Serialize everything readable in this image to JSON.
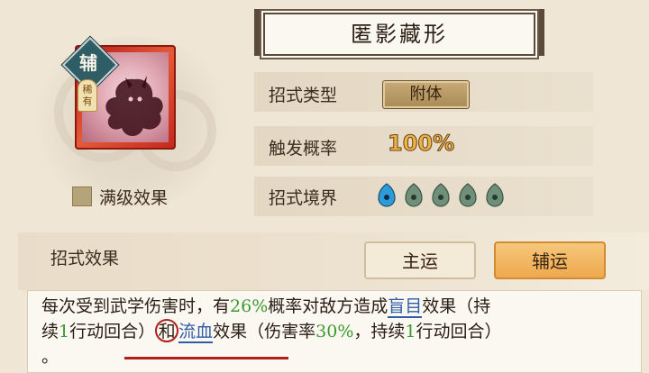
{
  "skill": {
    "name": "匿影藏形",
    "type_badge": "辅",
    "rarity": "稀有",
    "max_level_label": "满级效果"
  },
  "attributes": [
    {
      "label": "招式类型",
      "value": "附体"
    },
    {
      "label": "触发概率",
      "value": "100%"
    },
    {
      "label": "招式境界",
      "filled": 1,
      "total": 5
    }
  ],
  "effect": {
    "heading": "招式效果",
    "tabs": [
      {
        "label": "主运",
        "active": false
      },
      {
        "label": "辅运",
        "active": true
      }
    ],
    "description": {
      "line1_a": "每次受到武学伤害时，有",
      "pct1": "26%",
      "line1_b": "概率对敌方造成",
      "term1": "盲目",
      "line1_c": "效果（持",
      "line2_a": "续",
      "num1": "1",
      "line2_b": "行动回合）",
      "conj": "和",
      "term2": "流血",
      "line2_c": "效果（伤害率",
      "pct2": "30%",
      "line2_d": "，持续",
      "num2": "1",
      "line2_e": "行动回合）",
      "line3": "。"
    }
  },
  "colors": {
    "highlight_number": "#3c9a2e",
    "highlight_term": "#2f5ca8",
    "annotation": "#b0201a",
    "active_tab": "#eea94f"
  }
}
